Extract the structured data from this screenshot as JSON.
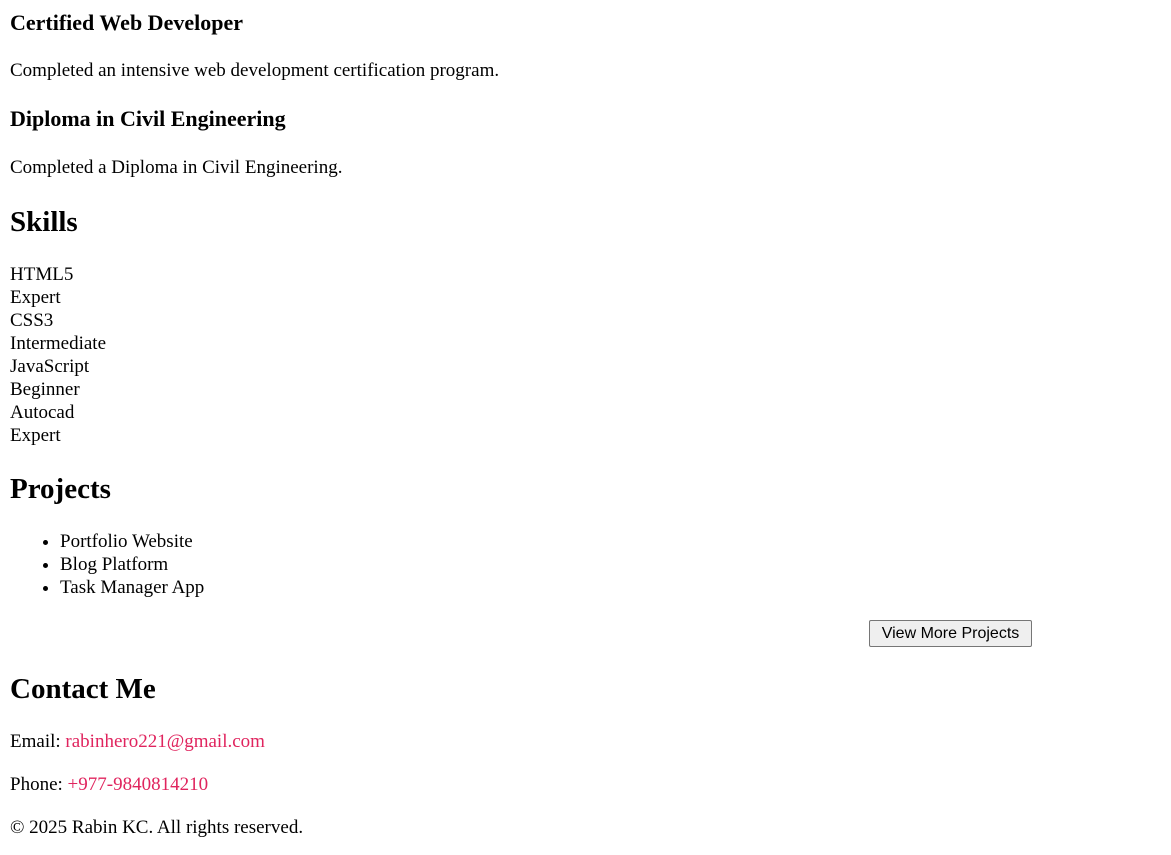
{
  "certifications": [
    {
      "title": "Certified Web Developer",
      "description": "Completed an intensive web development certification program."
    },
    {
      "title": "Diploma in Civil Engineering",
      "description": "Completed a Diploma in Civil Engineering."
    }
  ],
  "skills": {
    "heading": "Skills",
    "items": [
      {
        "name": "HTML5",
        "level": "Expert"
      },
      {
        "name": "CSS3",
        "level": "Intermediate"
      },
      {
        "name": "JavaScript",
        "level": "Beginner"
      },
      {
        "name": "Autocad",
        "level": "Expert"
      }
    ]
  },
  "projects": {
    "heading": "Projects",
    "items": [
      "Portfolio Website",
      "Blog Platform",
      "Task Manager App"
    ],
    "button_label": "View More Projects"
  },
  "contact": {
    "heading": "Contact Me",
    "email_label": "Email: ",
    "email": "rabinhero221@gmail.com",
    "phone_label": "Phone: ",
    "phone": "+977-9840814210"
  },
  "footer": {
    "copyright": "© 2025 Rabin KC. All rights reserved."
  },
  "colors": {
    "link": "#e0245e"
  }
}
